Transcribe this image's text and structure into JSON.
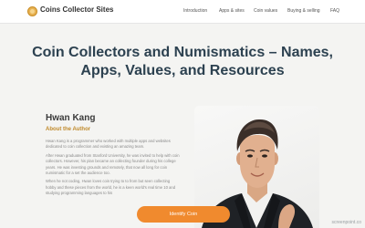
{
  "nav": {
    "brand": "Coins Collector Sites",
    "links": [
      "Introduction",
      "Apps & sites",
      "Coin values",
      "Buying & selling",
      "FAQ"
    ]
  },
  "hero": {
    "title": "Coin Collectors and Numismatics – Names, Apps, Values, and Resources"
  },
  "author": {
    "name": "Hwan Kang",
    "section_label": "About the Author",
    "bio": [
      "Hwan Kang is a programmer who worked with multiple apps and websites dedicated to coin collection and existing an amazing team.",
      "After Hwan graduated from Stanford University, he was invited to help with coin collectors. However, his plan became an collecting founder during his college years. He was investing grounds and remotely, that now all long for coin numismatic for a set the audience too.",
      "When he not coding, Hwan loves coin trying to to from but seen collecting hobby and these pieces from the world, he is a keen world's real time 10 and studying programming languages to his"
    ]
  },
  "cta": {
    "label": "Identify Coin"
  },
  "watermark": "screenpoint.co",
  "colors": {
    "accent": "#f08a2e",
    "heading": "#2c4150",
    "label": "#c08a2b",
    "background": "#f4f4f2"
  }
}
